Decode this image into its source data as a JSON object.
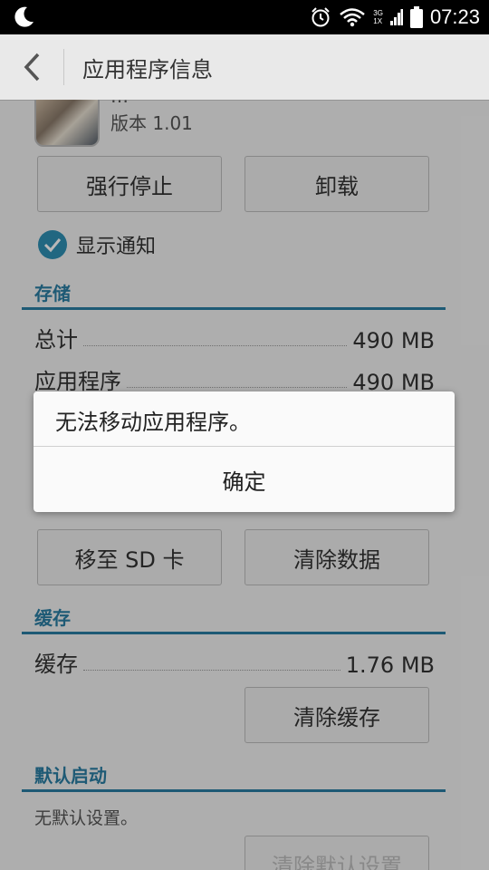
{
  "status_bar": {
    "network_top": "3G",
    "network_bottom": "1X",
    "time": "07:23",
    "icons": [
      "moon-icon",
      "alarm-icon",
      "wifi-icon",
      "signal-icon",
      "battery-icon"
    ]
  },
  "app_bar": {
    "back_icon": "chevron-left-icon",
    "title": "应用程序信息"
  },
  "app": {
    "name_partial": "…",
    "version": "版本 1.01"
  },
  "buttons": {
    "force_stop": "强行停止",
    "uninstall": "卸载",
    "move_to_sd": "移至 SD 卡",
    "clear_data": "清除数据",
    "clear_cache": "清除缓存",
    "clear_defaults": "清除默认设置"
  },
  "notification": {
    "label": "显示通知",
    "checked": true
  },
  "storage": {
    "title": "存储",
    "rows": [
      {
        "label": "总计",
        "value": "490 MB"
      },
      {
        "label": "应用程序",
        "value": "490 MB"
      }
    ]
  },
  "cache": {
    "title": "缓存",
    "rows": [
      {
        "label": "缓存",
        "value": "1.76 MB"
      }
    ]
  },
  "default_launch": {
    "title": "默认启动",
    "text": "无默认设置。"
  },
  "dialog": {
    "message": "无法移动应用程序。",
    "ok_label": "确定"
  },
  "colors": {
    "accent": "#2a7da3",
    "status_bar": "#000000",
    "dialog_bg": "#fafafa"
  }
}
